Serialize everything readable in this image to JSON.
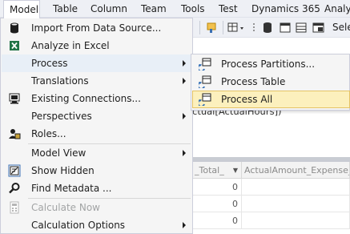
{
  "menubar": {
    "items": [
      {
        "label": "Model"
      },
      {
        "label": "Table"
      },
      {
        "label": "Column"
      },
      {
        "label": "Team"
      },
      {
        "label": "Tools"
      },
      {
        "label": "Test"
      },
      {
        "label": "Dynamics 365"
      },
      {
        "label": "Analy"
      }
    ]
  },
  "toolbar": {
    "select_label": "Sele"
  },
  "formula_bar": {
    "text": "ctual[ActualHours])"
  },
  "grid": {
    "columns": [
      {
        "label": "_Total_"
      },
      {
        "label": "ActualAmount_Expense_"
      }
    ],
    "rows": [
      {
        "value": "0"
      },
      {
        "value": "0"
      },
      {
        "value": "0"
      }
    ]
  },
  "model_menu": {
    "items": [
      {
        "label": "Import From Data Source...",
        "icon": "database-import-icon"
      },
      {
        "label": "Analyze in Excel",
        "icon": "excel-icon"
      },
      {
        "label": "Process",
        "icon": "none",
        "submenu": true,
        "highlighted": true
      },
      {
        "label": "Translations",
        "icon": "none",
        "submenu": true
      },
      {
        "label": "Existing Connections...",
        "icon": "connections-icon"
      },
      {
        "label": "Perspectives",
        "icon": "none",
        "submenu": true
      },
      {
        "label": "Roles...",
        "icon": "roles-icon"
      },
      {
        "label": "Model View",
        "icon": "none",
        "submenu": true
      },
      {
        "label": "Show Hidden",
        "icon": "show-hidden-icon"
      },
      {
        "label": "Find Metadata ...",
        "icon": "search-icon"
      },
      {
        "label": "Calculate Now",
        "icon": "calculate-icon",
        "disabled": true
      },
      {
        "label": "Calculation Options",
        "icon": "none",
        "submenu": true
      }
    ]
  },
  "process_submenu": {
    "items": [
      {
        "label": "Process Partitions...",
        "icon": "process-icon"
      },
      {
        "label": "Process Table",
        "icon": "process-icon"
      },
      {
        "label": "Process All",
        "icon": "process-icon",
        "highlighted": true
      }
    ]
  },
  "colors": {
    "menu_bg": "#f5f5f5",
    "menu_highlight": "#e8eff7",
    "submenu_highlight": "#fcf0bd",
    "submenu_highlight_border": "#e5c365",
    "disabled_text": "#a2a4a5"
  }
}
